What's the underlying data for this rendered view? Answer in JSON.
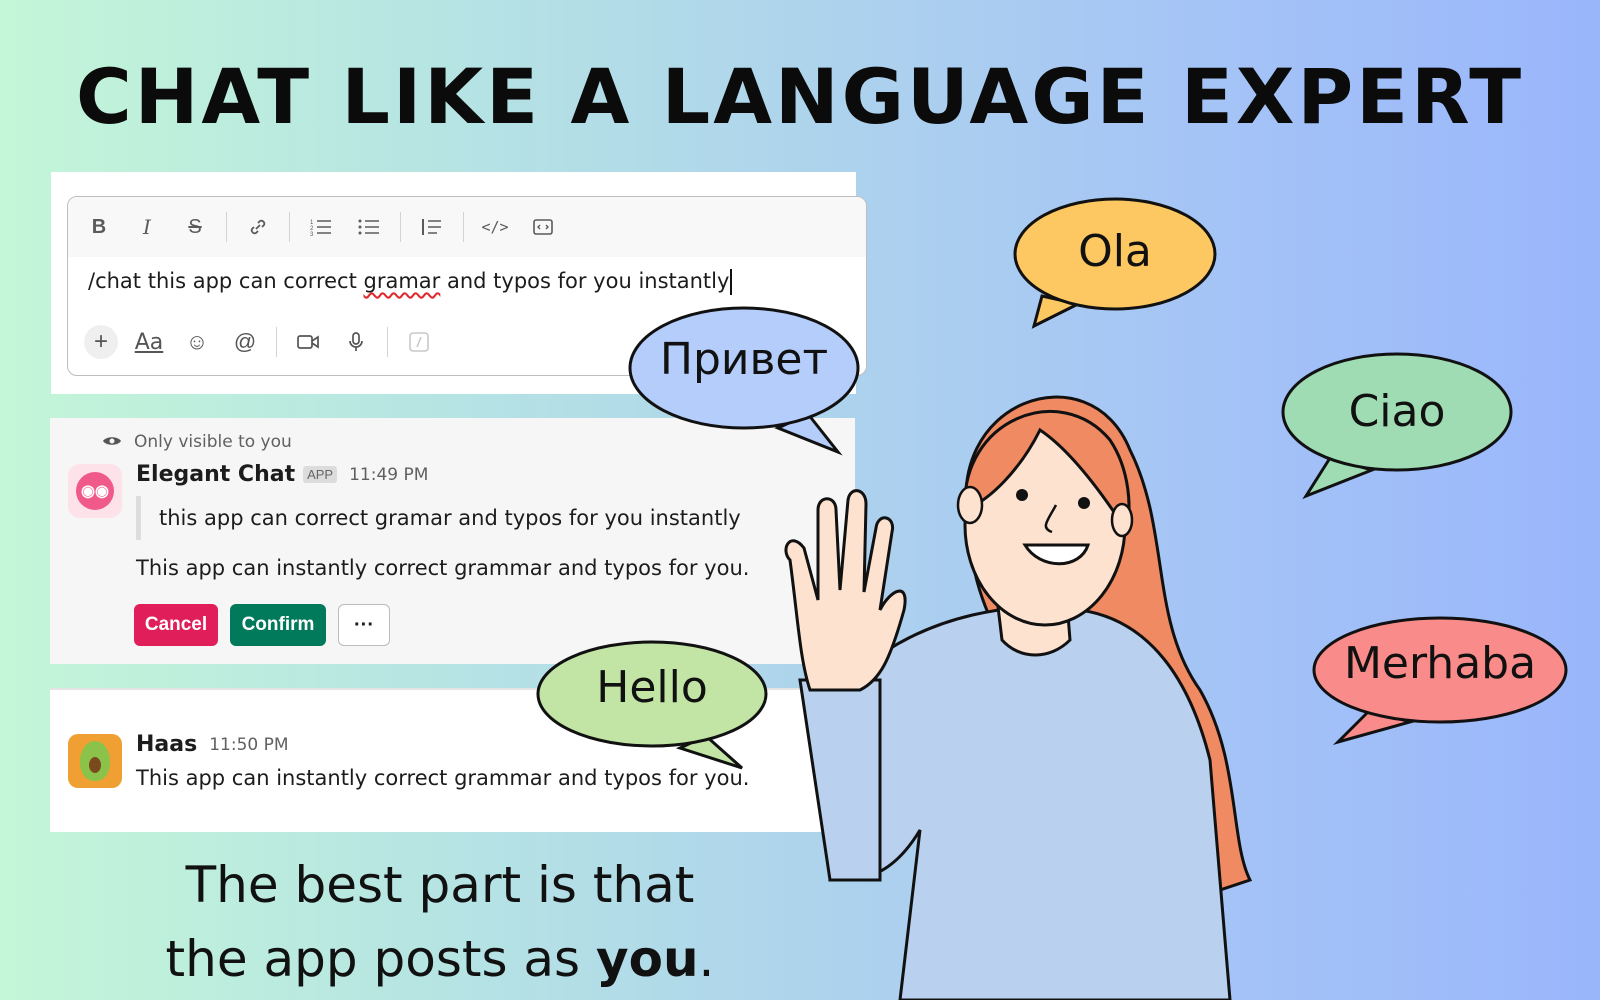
{
  "headline": "CHAT LIKE A LANGUAGE EXPERT",
  "composer": {
    "toolbar_icons": [
      "bold-icon",
      "italic-icon",
      "strikethrough-icon",
      "link-icon",
      "ordered-list-icon",
      "bullet-list-icon",
      "blockquote-icon",
      "code-icon",
      "code-block-icon"
    ],
    "toolbar_glyphs": {
      "bold": "B",
      "italic": "I",
      "strike": "S",
      "link": "🔗",
      "ordered": "☰",
      "bullet": "☰",
      "quote": "❘≡",
      "code": "</>",
      "codeblock": "⌨"
    },
    "text_prefix": "/chat this app can correct ",
    "text_error": "gramar",
    "text_suffix": " and typos for you instantly",
    "action_glyphs": {
      "plus": "+",
      "aa": "Aa",
      "emoji": "☺",
      "mention": "@",
      "video": "▭",
      "mic": "🎙",
      "slash": "⁄"
    }
  },
  "ephemeral": {
    "visibility": "Only visible to you",
    "sender": "Elegant Chat",
    "badge": "APP",
    "time": "11:49 PM",
    "quoted": "this app can correct gramar and typos for you instantly",
    "corrected": "This app can instantly correct grammar and typos for you.",
    "cancel": "Cancel",
    "confirm": "Confirm",
    "more": "···",
    "avatar_glyph": "◉◉"
  },
  "posted": {
    "sender": "Haas",
    "time": "11:50 PM",
    "text": "This app can instantly correct grammar and typos for you."
  },
  "caption": {
    "line1": "The best part is that",
    "line2_prefix": "the app posts as ",
    "line2_bold": "you",
    "line2_suffix": "."
  },
  "bubbles": {
    "ola": "Ola",
    "privet": "Привет",
    "ciao": "Ciao",
    "hello": "Hello",
    "merhaba": "Merhaba"
  },
  "colors": {
    "ola": "#fdc861",
    "privet": "#b5cdfa",
    "ciao": "#9fdcb4",
    "hello": "#c2e5a6",
    "merhaba": "#f98c8a",
    "cancel": "#e01e5a",
    "confirm": "#007a5a"
  }
}
